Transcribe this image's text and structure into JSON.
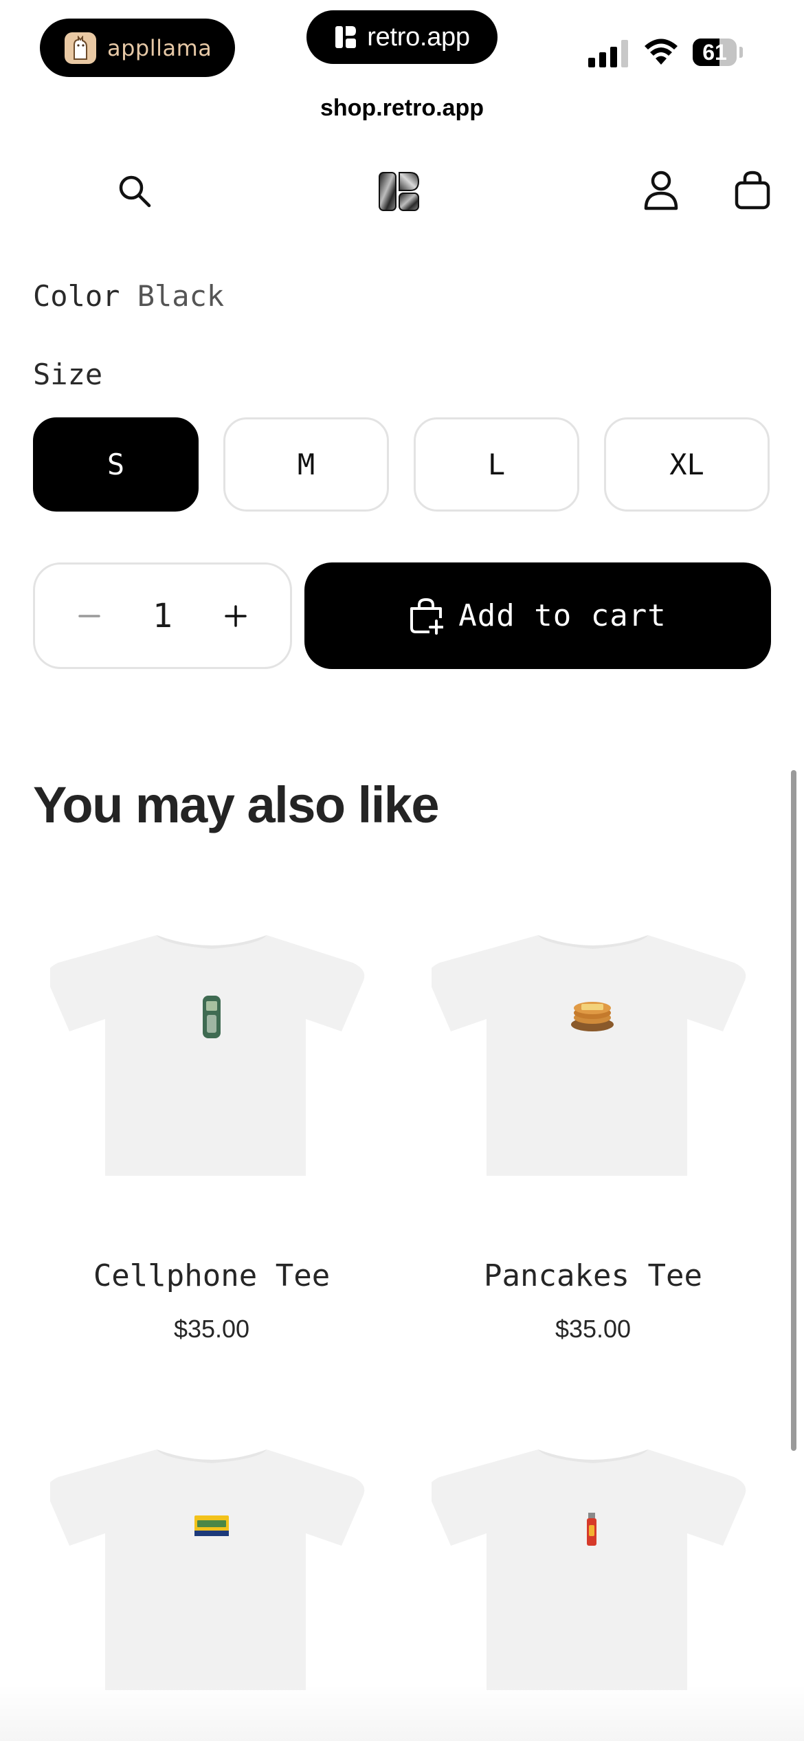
{
  "status_bar": {
    "left_pill_label": "appllama",
    "center_pill_label": "retro.app",
    "battery_level": "61",
    "signal_icon": "signal-bars-icon",
    "wifi_icon": "wifi-icon"
  },
  "browser": {
    "url": "shop.retro.app"
  },
  "header": {
    "search_icon": "search-icon",
    "logo_icon": "retro-logo-icon",
    "account_icon": "account-icon",
    "cart_icon": "bag-icon"
  },
  "product": {
    "color_label": "Color",
    "color_value": "Black",
    "size_label": "Size",
    "sizes": [
      {
        "label": "S",
        "selected": true
      },
      {
        "label": "M",
        "selected": false
      },
      {
        "label": "L",
        "selected": false
      },
      {
        "label": "XL",
        "selected": false
      }
    ],
    "quantity": "1",
    "add_to_cart_label": "Add to cart"
  },
  "recommendations": {
    "title": "You may also like",
    "items": [
      {
        "title": "Cellphone Tee",
        "price": "$35.00",
        "graphic": "cellphone"
      },
      {
        "title": "Pancakes Tee",
        "price": "$35.00",
        "graphic": "pancakes"
      },
      {
        "title": "",
        "price": "",
        "graphic": "sticker-badge"
      },
      {
        "title": "",
        "price": "",
        "graphic": "lighter"
      }
    ]
  },
  "colors": {
    "primary": "#000000",
    "border": "#e3e3e3",
    "tee": "#f1f1f1",
    "llama_text": "#e6c8a6"
  }
}
